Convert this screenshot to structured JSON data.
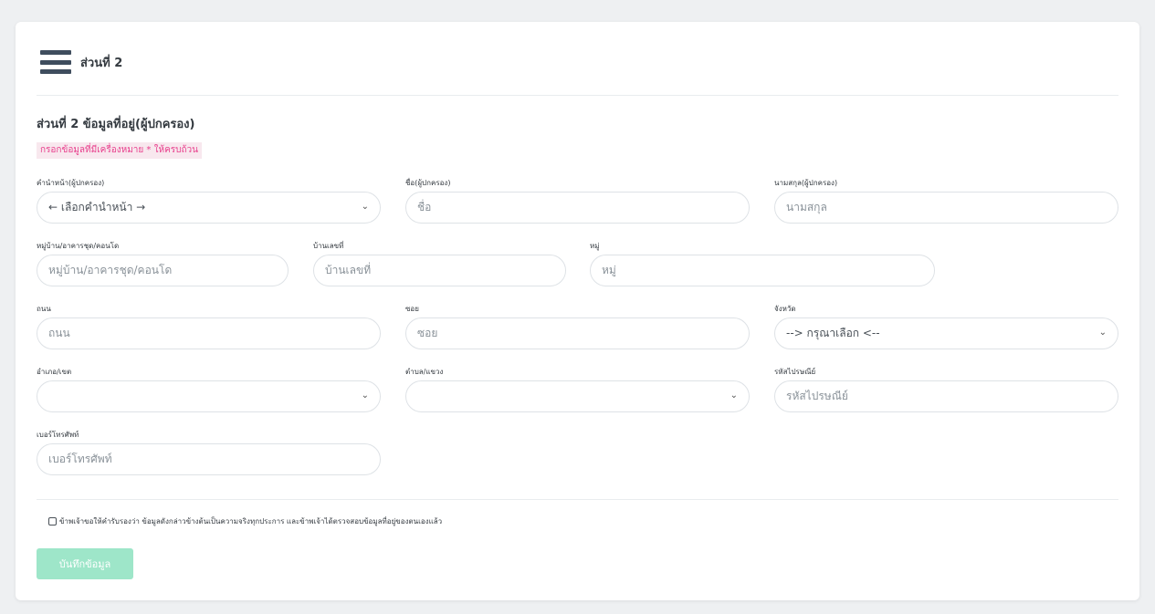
{
  "header": {
    "title": "ส่วนที่ 2"
  },
  "section": {
    "title": "ส่วนที่ 2 ข้อมูลที่อยู่(ผู้ปกครอง)",
    "required_note": "กรอกข้อมูลที่มีเครื่องหมาย * ให้ครบถ้วน"
  },
  "fields": {
    "prefix": {
      "label": "คำนำหน้า(ผู้ปกครอง)",
      "value": "← เลือกคำนำหน้า →"
    },
    "first_name": {
      "label": "ชื่อ(ผู้ปกครอง)",
      "placeholder": "ชื่อ"
    },
    "last_name": {
      "label": "นามสกุล(ผู้ปกครอง)",
      "placeholder": "นามสกุล"
    },
    "village": {
      "label": "หมู่บ้าน/อาคารชุด/คอนโด",
      "placeholder": "หมู่บ้าน/อาคารชุด/คอนโด"
    },
    "house_no": {
      "label": "บ้านเลขที่",
      "placeholder": "บ้านเลขที่"
    },
    "moo": {
      "label": "หมู่",
      "placeholder": "หมู่"
    },
    "road": {
      "label": "ถนน",
      "placeholder": "ถนน"
    },
    "soi": {
      "label": "ซอย",
      "placeholder": "ซอย"
    },
    "province": {
      "label": "จังหวัด",
      "value": "--> กรุณาเลือก <--"
    },
    "district": {
      "label": "อำเภอ/เขต",
      "value": ""
    },
    "subdistrict": {
      "label": "ตำบล/แขวง",
      "value": ""
    },
    "postcode": {
      "label": "รหัสไปรษณีย์",
      "placeholder": "รหัสไปรษณีย์"
    },
    "phone": {
      "label": "เบอร์โทรศัพท์",
      "placeholder": "เบอร์โทรศัพท์"
    }
  },
  "consent": {
    "label": "ข้าพเจ้าขอให้คำรับรองว่า ข้อมูลดังกล่าวข้างต้นเป็นความจริงทุกประการ และข้าพเจ้าได้ตรวจสอบข้อมูลที่อยู่ของตนเองแล้ว",
    "checked": false
  },
  "actions": {
    "save_label": "บันทึกข้อมูล"
  },
  "icons": {
    "menu": "hamburger-icon",
    "dropdown": "chevron-down-icon"
  },
  "colors": {
    "save_button": "#9ee6c9",
    "warning_text": "#e83e8c",
    "warning_bg": "#f8e8ee"
  }
}
